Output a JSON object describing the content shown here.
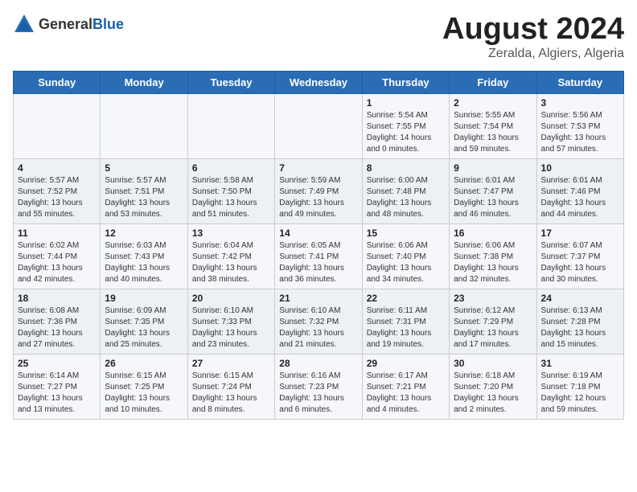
{
  "header": {
    "logo_general": "General",
    "logo_blue": "Blue",
    "main_title": "August 2024",
    "subtitle": "Zeralda, Algiers, Algeria"
  },
  "days_of_week": [
    "Sunday",
    "Monday",
    "Tuesday",
    "Wednesday",
    "Thursday",
    "Friday",
    "Saturday"
  ],
  "weeks": [
    [
      {
        "day": "",
        "info": ""
      },
      {
        "day": "",
        "info": ""
      },
      {
        "day": "",
        "info": ""
      },
      {
        "day": "",
        "info": ""
      },
      {
        "day": "1",
        "info": "Sunrise: 5:54 AM\nSunset: 7:55 PM\nDaylight: 14 hours\nand 0 minutes."
      },
      {
        "day": "2",
        "info": "Sunrise: 5:55 AM\nSunset: 7:54 PM\nDaylight: 13 hours\nand 59 minutes."
      },
      {
        "day": "3",
        "info": "Sunrise: 5:56 AM\nSunset: 7:53 PM\nDaylight: 13 hours\nand 57 minutes."
      }
    ],
    [
      {
        "day": "4",
        "info": "Sunrise: 5:57 AM\nSunset: 7:52 PM\nDaylight: 13 hours\nand 55 minutes."
      },
      {
        "day": "5",
        "info": "Sunrise: 5:57 AM\nSunset: 7:51 PM\nDaylight: 13 hours\nand 53 minutes."
      },
      {
        "day": "6",
        "info": "Sunrise: 5:58 AM\nSunset: 7:50 PM\nDaylight: 13 hours\nand 51 minutes."
      },
      {
        "day": "7",
        "info": "Sunrise: 5:59 AM\nSunset: 7:49 PM\nDaylight: 13 hours\nand 49 minutes."
      },
      {
        "day": "8",
        "info": "Sunrise: 6:00 AM\nSunset: 7:48 PM\nDaylight: 13 hours\nand 48 minutes."
      },
      {
        "day": "9",
        "info": "Sunrise: 6:01 AM\nSunset: 7:47 PM\nDaylight: 13 hours\nand 46 minutes."
      },
      {
        "day": "10",
        "info": "Sunrise: 6:01 AM\nSunset: 7:46 PM\nDaylight: 13 hours\nand 44 minutes."
      }
    ],
    [
      {
        "day": "11",
        "info": "Sunrise: 6:02 AM\nSunset: 7:44 PM\nDaylight: 13 hours\nand 42 minutes."
      },
      {
        "day": "12",
        "info": "Sunrise: 6:03 AM\nSunset: 7:43 PM\nDaylight: 13 hours\nand 40 minutes."
      },
      {
        "day": "13",
        "info": "Sunrise: 6:04 AM\nSunset: 7:42 PM\nDaylight: 13 hours\nand 38 minutes."
      },
      {
        "day": "14",
        "info": "Sunrise: 6:05 AM\nSunset: 7:41 PM\nDaylight: 13 hours\nand 36 minutes."
      },
      {
        "day": "15",
        "info": "Sunrise: 6:06 AM\nSunset: 7:40 PM\nDaylight: 13 hours\nand 34 minutes."
      },
      {
        "day": "16",
        "info": "Sunrise: 6:06 AM\nSunset: 7:38 PM\nDaylight: 13 hours\nand 32 minutes."
      },
      {
        "day": "17",
        "info": "Sunrise: 6:07 AM\nSunset: 7:37 PM\nDaylight: 13 hours\nand 30 minutes."
      }
    ],
    [
      {
        "day": "18",
        "info": "Sunrise: 6:08 AM\nSunset: 7:36 PM\nDaylight: 13 hours\nand 27 minutes."
      },
      {
        "day": "19",
        "info": "Sunrise: 6:09 AM\nSunset: 7:35 PM\nDaylight: 13 hours\nand 25 minutes."
      },
      {
        "day": "20",
        "info": "Sunrise: 6:10 AM\nSunset: 7:33 PM\nDaylight: 13 hours\nand 23 minutes."
      },
      {
        "day": "21",
        "info": "Sunrise: 6:10 AM\nSunset: 7:32 PM\nDaylight: 13 hours\nand 21 minutes."
      },
      {
        "day": "22",
        "info": "Sunrise: 6:11 AM\nSunset: 7:31 PM\nDaylight: 13 hours\nand 19 minutes."
      },
      {
        "day": "23",
        "info": "Sunrise: 6:12 AM\nSunset: 7:29 PM\nDaylight: 13 hours\nand 17 minutes."
      },
      {
        "day": "24",
        "info": "Sunrise: 6:13 AM\nSunset: 7:28 PM\nDaylight: 13 hours\nand 15 minutes."
      }
    ],
    [
      {
        "day": "25",
        "info": "Sunrise: 6:14 AM\nSunset: 7:27 PM\nDaylight: 13 hours\nand 13 minutes."
      },
      {
        "day": "26",
        "info": "Sunrise: 6:15 AM\nSunset: 7:25 PM\nDaylight: 13 hours\nand 10 minutes."
      },
      {
        "day": "27",
        "info": "Sunrise: 6:15 AM\nSunset: 7:24 PM\nDaylight: 13 hours\nand 8 minutes."
      },
      {
        "day": "28",
        "info": "Sunrise: 6:16 AM\nSunset: 7:23 PM\nDaylight: 13 hours\nand 6 minutes."
      },
      {
        "day": "29",
        "info": "Sunrise: 6:17 AM\nSunset: 7:21 PM\nDaylight: 13 hours\nand 4 minutes."
      },
      {
        "day": "30",
        "info": "Sunrise: 6:18 AM\nSunset: 7:20 PM\nDaylight: 13 hours\nand 2 minutes."
      },
      {
        "day": "31",
        "info": "Sunrise: 6:19 AM\nSunset: 7:18 PM\nDaylight: 12 hours\nand 59 minutes."
      }
    ]
  ]
}
